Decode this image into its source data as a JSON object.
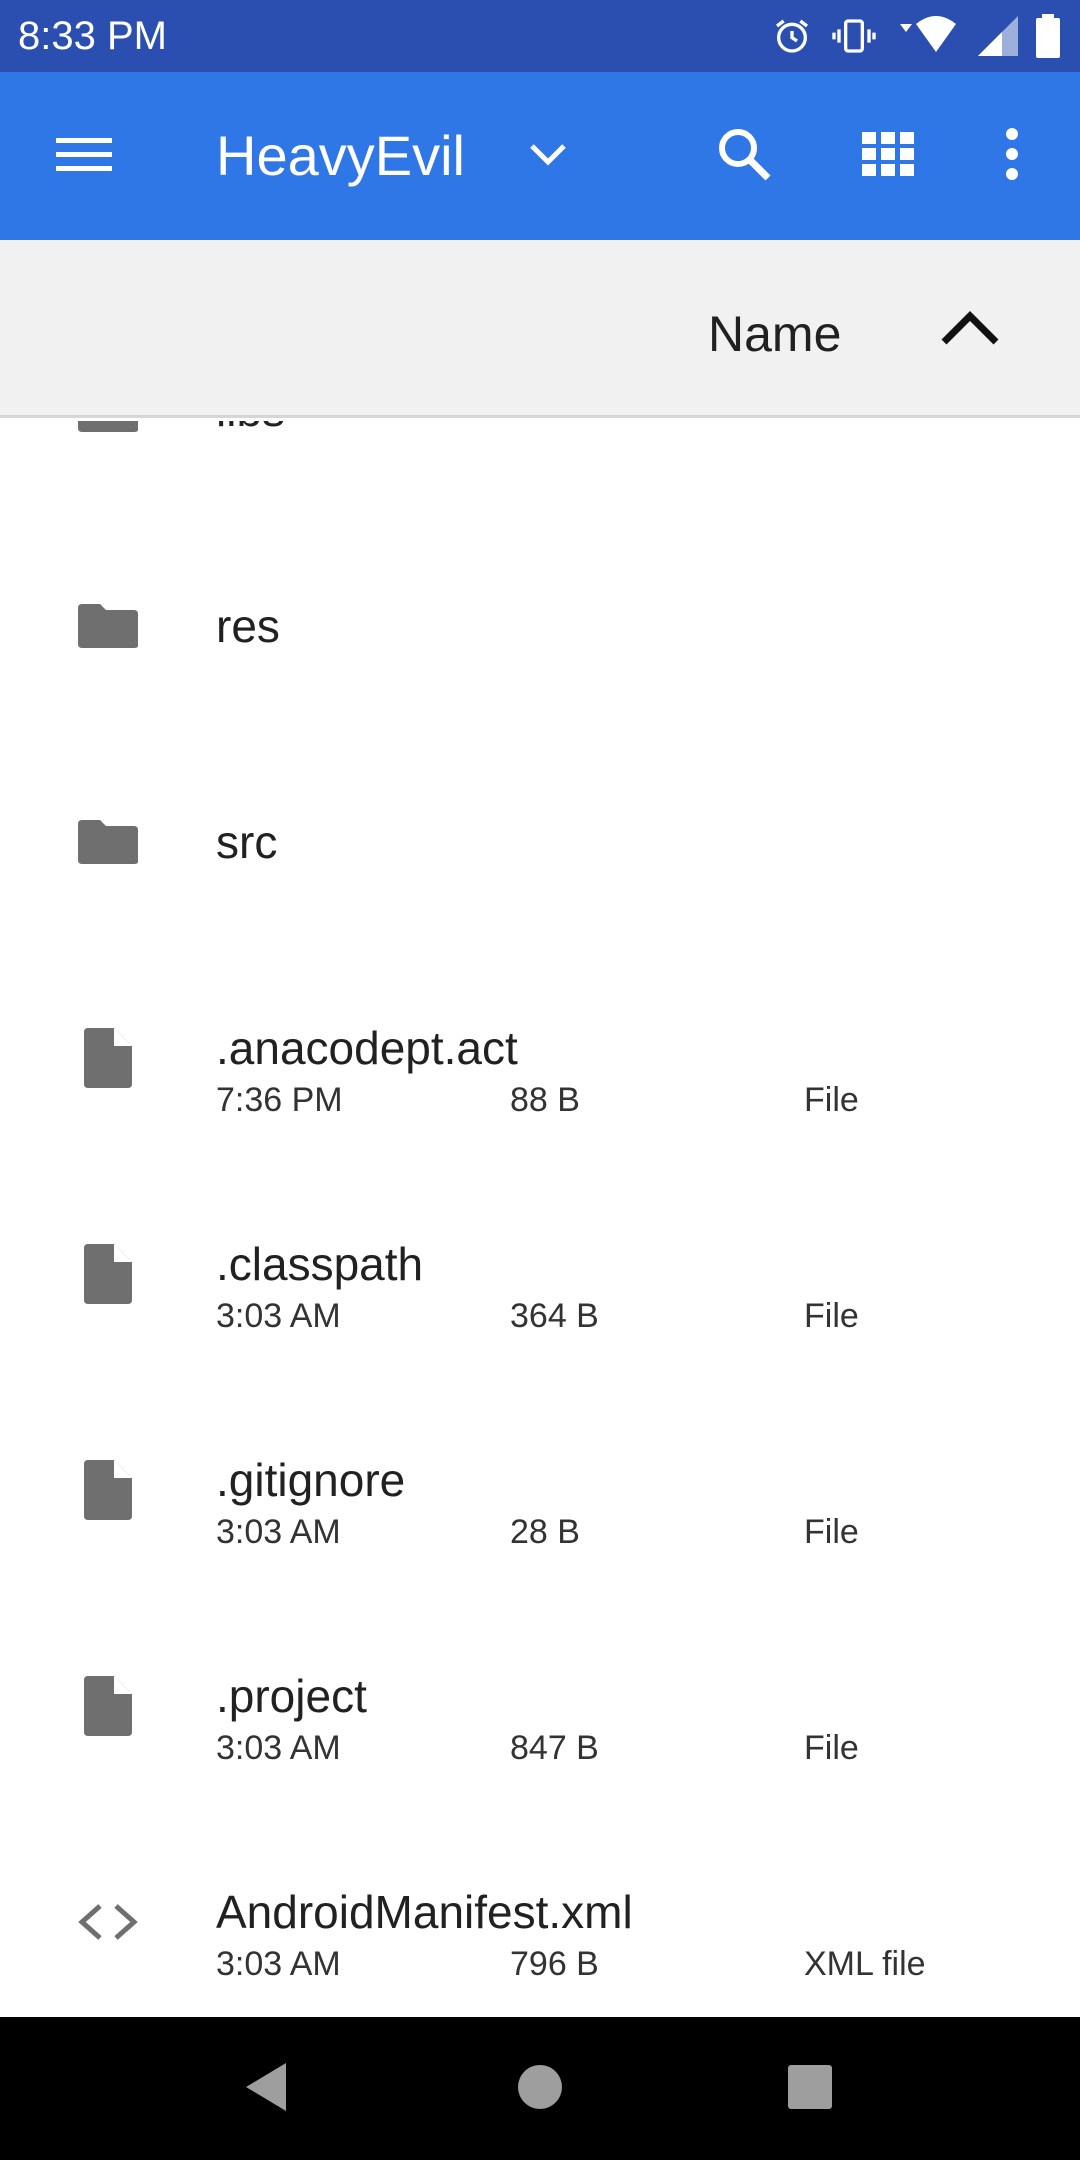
{
  "status_bar": {
    "time": "8:33 PM",
    "icons": [
      "alarm-icon",
      "vibrate-icon",
      "wifi-icon",
      "cell-signal-icon",
      "battery-icon"
    ]
  },
  "app_bar": {
    "title": "HeavyEvil",
    "icons": [
      "menu-icon",
      "chevron-down-icon",
      "search-icon",
      "grid-view-icon",
      "more-vert-icon"
    ],
    "color": "#2f76e6"
  },
  "sort_bar": {
    "label": "Name",
    "direction": "ascending"
  },
  "files": [
    {
      "name": "libs",
      "type": "folder"
    },
    {
      "name": "res",
      "type": "folder"
    },
    {
      "name": "src",
      "type": "folder"
    },
    {
      "name": ".anacodept.act",
      "type": "file",
      "modified": "7:36 PM",
      "size": "88 B",
      "kind": "File"
    },
    {
      "name": ".classpath",
      "type": "file",
      "modified": "3:03 AM",
      "size": "364 B",
      "kind": "File"
    },
    {
      "name": ".gitignore",
      "type": "file",
      "modified": "3:03 AM",
      "size": "28 B",
      "kind": "File"
    },
    {
      "name": ".project",
      "type": "file",
      "modified": "3:03 AM",
      "size": "847 B",
      "kind": "File"
    },
    {
      "name": "AndroidManifest.xml",
      "type": "code",
      "modified": "3:03 AM",
      "size": "796 B",
      "kind": "XML file"
    }
  ],
  "nav_bar": {
    "buttons": [
      "back-icon",
      "home-icon",
      "recents-icon"
    ]
  }
}
